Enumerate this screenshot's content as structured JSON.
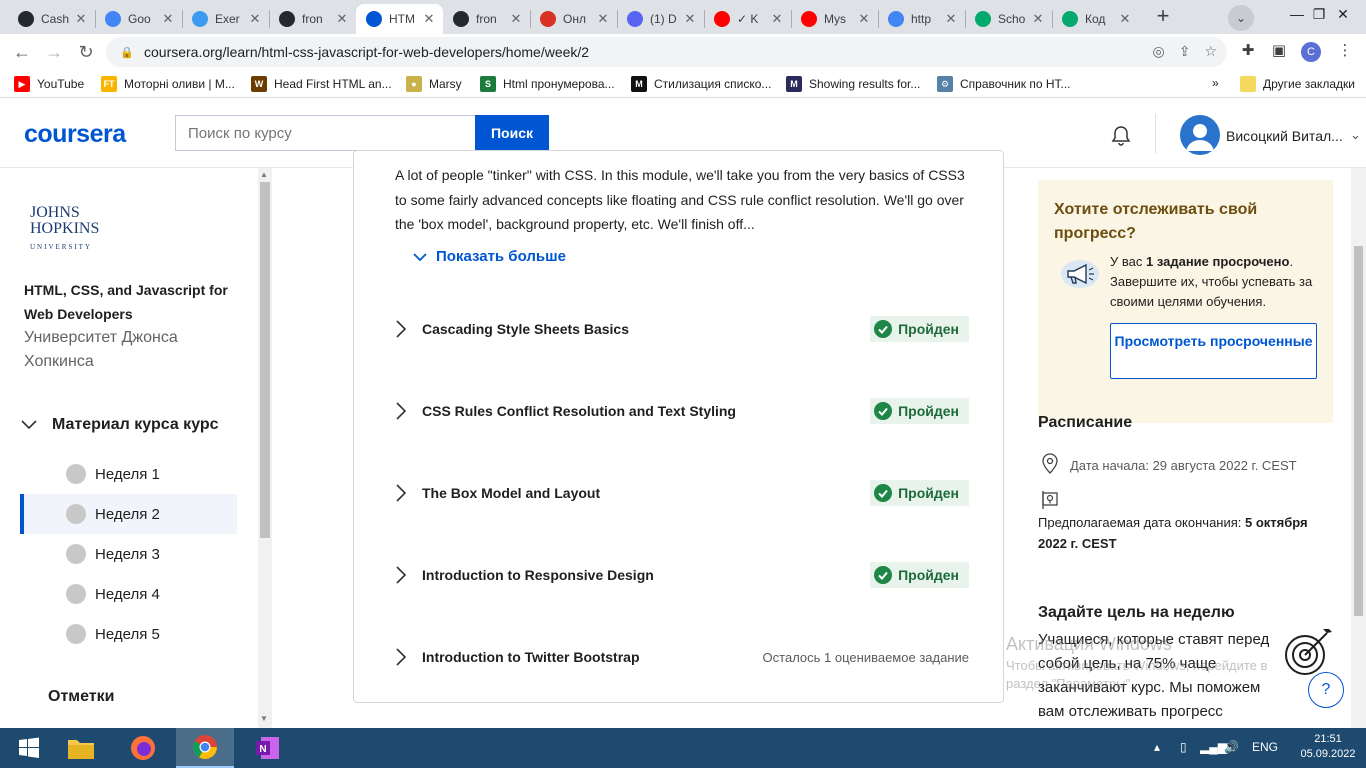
{
  "browser": {
    "tabs": [
      {
        "label": "Cash",
        "icon": "github-icon",
        "color": "#24292f"
      },
      {
        "label": "Goo",
        "icon": "google-translate-icon",
        "color": "#4285f4"
      },
      {
        "label": "Exer",
        "icon": "exercise-icon",
        "color": "#3c9bf0"
      },
      {
        "label": "fron",
        "icon": "github-icon",
        "color": "#24292f"
      },
      {
        "label": "HTM",
        "icon": "coursera-icon",
        "color": "#0056d2"
      },
      {
        "label": "fron",
        "icon": "github-icon",
        "color": "#24292f"
      },
      {
        "label": "Онл",
        "icon": "gmail-icon",
        "color": "#d93025"
      },
      {
        "label": "(1) D",
        "icon": "discord-icon",
        "color": "#5865f2"
      },
      {
        "label": "✓ K",
        "icon": "youtube-icon",
        "color": "#ff0000"
      },
      {
        "label": "Mys",
        "icon": "youtube-icon",
        "color": "#ff0000"
      },
      {
        "label": "http",
        "icon": "google-icon",
        "color": "#4285f4"
      },
      {
        "label": "Scho",
        "icon": "w3schools-icon",
        "color": "#04aa6d"
      },
      {
        "label": "Код",
        "icon": "w3schools-icon",
        "color": "#04aa6d"
      }
    ],
    "url": "coursera.org/learn/html-css-javascript-for-web-developers/home/week/2",
    "profile_initial": "C",
    "bookmarks": [
      {
        "label": "YouTube",
        "icon": "youtube-icon"
      },
      {
        "label": "Моторні оливи | M...",
        "icon": "ft-icon"
      },
      {
        "label": "Head First HTML an...",
        "icon": "w3-icon"
      },
      {
        "label": "Marsy",
        "icon": "marsy-icon"
      },
      {
        "label": "Html пронумерова...",
        "icon": "s-icon"
      },
      {
        "label": "Стилизация списко...",
        "icon": "m-icon"
      },
      {
        "label": "Showing results for...",
        "icon": "mdn-icon"
      },
      {
        "label": "Справочник по HT...",
        "icon": "gear-bookmark-icon"
      }
    ],
    "other_bookmarks": "Другие закладки"
  },
  "header": {
    "logo": "coursera",
    "search_placeholder": "Поиск по курсу",
    "search_button": "Поиск",
    "user_name": "Висоцкий Витал..."
  },
  "sidebar": {
    "university_logo_lines": [
      "JOHNS",
      "HOPKINS",
      "UNIVERSITY"
    ],
    "course_title": "HTML, CSS, and Javascript for Web Developers",
    "university": "Университет Джонса Хопкинса",
    "material_label": "Материал курса курс",
    "weeks": [
      "Неделя 1",
      "Неделя 2",
      "Неделя 3",
      "Неделя 4",
      "Неделя 5"
    ],
    "selected_week": "Неделя 2",
    "marks_label": "Отметки"
  },
  "module": {
    "description": "A lot of people \"tinker\" with CSS. In this module, we'll take you from the very basics of CSS3 to some fairly advanced concepts like floating and CSS rule conflict resolution. We'll go over the 'box model', background property, etc. We'll finish off...",
    "show_more": "Показать больше",
    "lessons": [
      {
        "title": "Cascading Style Sheets Basics",
        "status": "Пройден"
      },
      {
        "title": "CSS Rules Conflict Resolution and Text Styling",
        "status": "Пройден"
      },
      {
        "title": "The Box Model and Layout",
        "status": "Пройден"
      },
      {
        "title": "Introduction to Responsive Design",
        "status": "Пройден"
      },
      {
        "title": "Introduction to Twitter Bootstrap",
        "status": "Осталось 1 оцениваемое задание"
      }
    ]
  },
  "right_panel": {
    "progress_title": "Хотите отслеживать свой прогресс?",
    "progress_text_pre": "У вас ",
    "progress_text_bold": "1 задание просрочено",
    "progress_text_post": ". Завершите их, чтобы успевать за своими целями обучения.",
    "progress_button": "Просмотреть просроченные",
    "schedule_title": "Расписание",
    "start_date": "Дата начала: 29 августа 2022 г. CEST",
    "end_date_label": "Предполагаемая дата окончания: ",
    "end_date_value": "5 октября 2022 г. CEST",
    "goal_title": "Задайте цель на неделю",
    "goal_text": "Учащиеся, которые ставят перед собой цель, на 75% чаще заканчивают курс. Мы поможем вам отслеживать прогресс",
    "help_label": "?"
  },
  "watermark": {
    "title": "Активация Windows",
    "subtitle": "Чтобы активировать Windows, перейдите в раздел \"Параметры\"."
  },
  "taskbar": {
    "language": "ENG",
    "time": "21:51",
    "date": "05.09.2022"
  }
}
